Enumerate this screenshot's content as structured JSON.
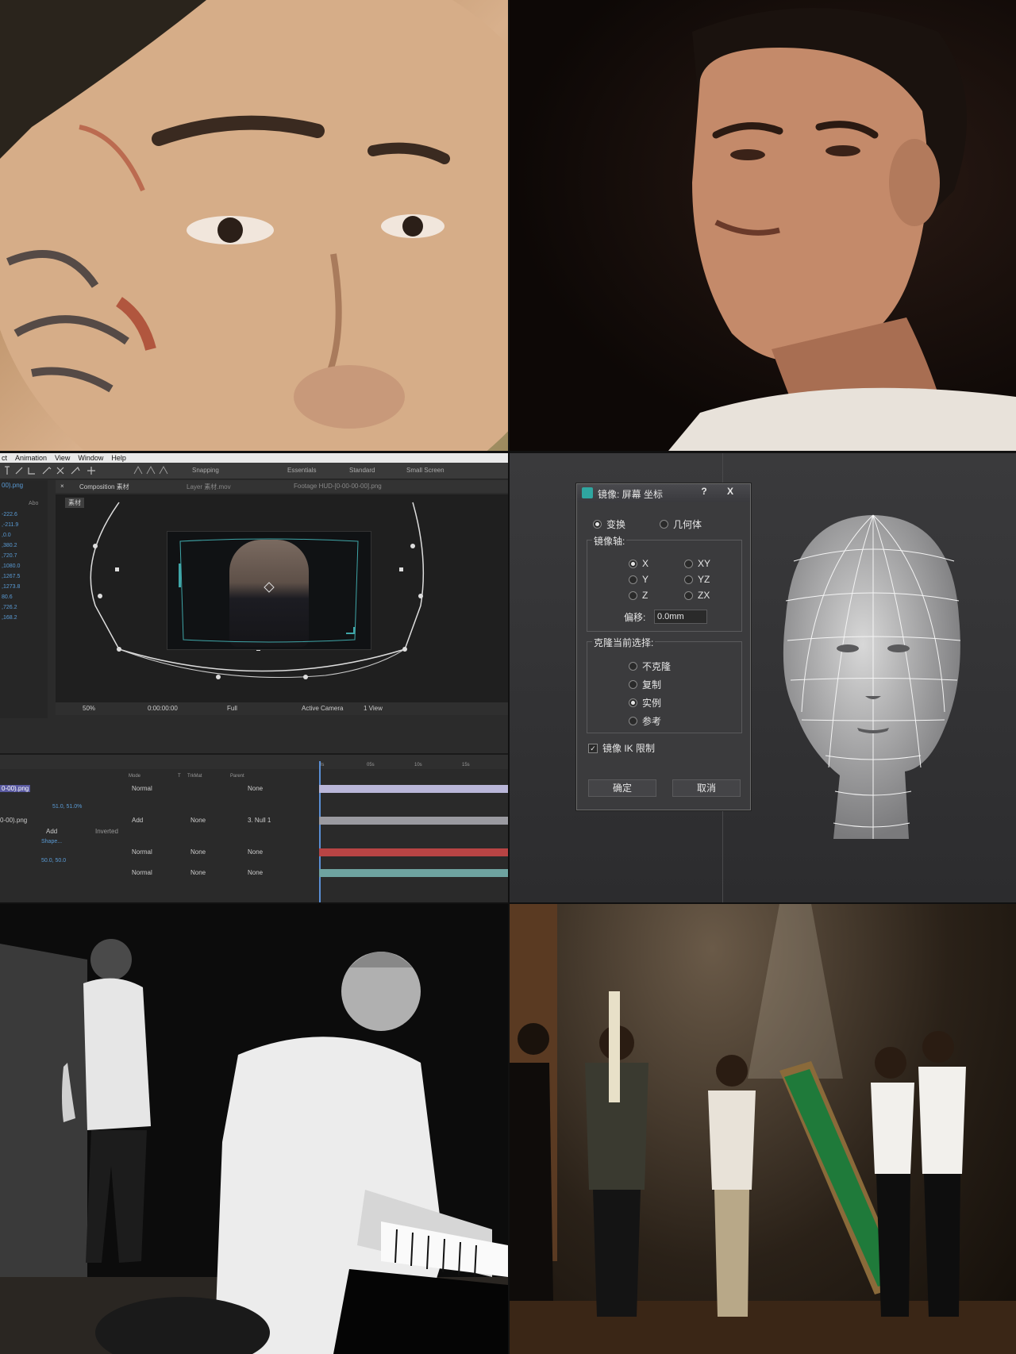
{
  "ae": {
    "menu": [
      "ct",
      "Animation",
      "View",
      "Window",
      "Help"
    ],
    "toolbar": {
      "snapping": "Snapping",
      "workspaces": [
        "Essentials",
        "Standard",
        "Small Screen"
      ]
    },
    "left_file": "00).png",
    "left_label": "Abo",
    "left_values": [
      "-222.6",
      ",-211.9",
      ",0.0",
      ",380.2",
      ",720.7",
      ",1080.0",
      ",1267.5",
      ",1273.8",
      "80.6",
      ",726.2",
      ",168.2"
    ],
    "tabs": {
      "composition": "Composition 素材",
      "layer": "Layer 素材.mov",
      "footage": "Footage HUD-[0-00-00-00].png"
    },
    "comp_tag": "素材",
    "viewer_controls": {
      "zoom": "50%",
      "timecode": "0:00:00:00",
      "resolution": "Full",
      "camera": "Active Camera",
      "views": "1 View"
    },
    "timeline": {
      "columns": [
        "Mode",
        "T",
        "TrkMat",
        "Parent"
      ],
      "ruler": [
        "0s",
        "05s",
        "10s",
        "15s"
      ],
      "layers": [
        {
          "name": "0-00).png",
          "mode": "Normal",
          "trkmat": "",
          "parent": "None"
        },
        {
          "name": "0-00).png",
          "mode": "Add",
          "trkmat": "None",
          "parent": "3. Null 1",
          "scale": "51.0, 51.0%",
          "mask_mode": "Add",
          "inverted": "Inverted",
          "shape": "Shape..."
        },
        {
          "name": "",
          "mode": "Normal",
          "trkmat": "None",
          "parent": "None"
        },
        {
          "name": "",
          "mode": "Normal",
          "trkmat": "None",
          "parent": "None",
          "scale": "50.0, 50.0"
        }
      ]
    }
  },
  "dialog": {
    "title": "镜像: 屏幕 坐标",
    "help": "?",
    "close": "X",
    "mode_transform": "变换",
    "mode_geometry": "几何体",
    "axis_group": "镜像轴:",
    "axes": [
      "X",
      "XY",
      "Y",
      "YZ",
      "Z",
      "ZX"
    ],
    "offset_label": "偏移:",
    "offset_value": "0.0mm",
    "clone_group": "克隆当前选择:",
    "clone_options": [
      "不克隆",
      "复制",
      "实例",
      "参考"
    ],
    "ik_label": "镜像 IK 限制",
    "ok": "确定",
    "cancel": "取消"
  },
  "colors": {
    "ae_layer_red": "#b84444",
    "ae_layer_lilac": "#b9b6d8",
    "ae_layer_teal": "#6ea3a0",
    "dialog_bg": "#3b3b3d",
    "green_screen": "#1f7a3a"
  }
}
